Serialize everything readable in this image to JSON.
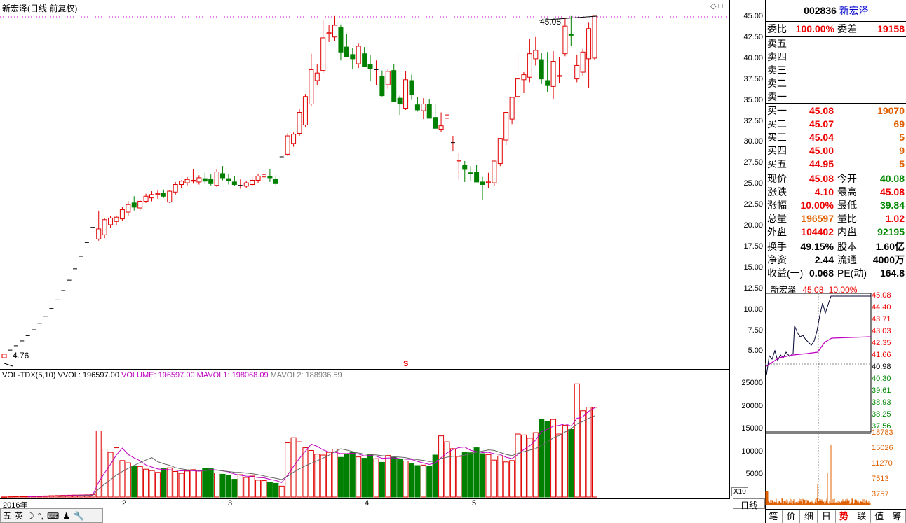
{
  "stock": {
    "code": "002836",
    "name": "新宏泽"
  },
  "chart": {
    "title": "新宏泽(日线 前复权)",
    "corner_icons": "◇ □",
    "high_label": "45.08",
    "low_label": "4.76",
    "marker_s": "S",
    "price_ticks": [
      "45.00",
      "42.50",
      "40.00",
      "37.50",
      "35.00",
      "32.50",
      "30.00",
      "27.50",
      "25.00",
      "22.50",
      "20.00",
      "17.50",
      "15.00",
      "12.50",
      "10.00",
      "7.50",
      "5.00"
    ],
    "vol_ticks": [
      "25000",
      "20000",
      "15000",
      "10000",
      "5000"
    ],
    "vol_multiplier": "X10",
    "date_labels": [
      "2016年",
      "2",
      "3",
      "4",
      "5"
    ],
    "period_tab": "日线",
    "volume_header": {
      "name": "VOL-TDX(5,10)",
      "vvol": "VVOL: 196597.00",
      "volume": "VOLUME: 196597.00",
      "mavol1": "MAVOL1: 198068.09",
      "mavol2": "MAVOL2: 188936.59"
    },
    "up_color": "#e00000",
    "down_color": "#008000",
    "candles": [
      [
        4.33,
        4.76,
        4.33,
        4.76
      ],
      [
        5.24,
        5.24,
        5.24,
        5.24
      ],
      [
        5.76,
        5.76,
        5.76,
        5.76
      ],
      [
        6.34,
        6.34,
        6.34,
        6.34
      ],
      [
        6.97,
        6.97,
        6.97,
        6.97
      ],
      [
        7.67,
        7.67,
        7.67,
        7.67
      ],
      [
        8.44,
        8.44,
        8.44,
        8.44
      ],
      [
        9.28,
        9.28,
        9.28,
        9.28
      ],
      [
        10.21,
        10.21,
        10.21,
        10.21
      ],
      [
        11.23,
        11.23,
        11.23,
        11.23
      ],
      [
        12.35,
        12.35,
        12.35,
        12.35
      ],
      [
        13.59,
        13.59,
        13.59,
        13.59
      ],
      [
        14.95,
        14.95,
        14.95,
        14.95
      ],
      [
        16.44,
        16.44,
        16.44,
        16.44
      ],
      [
        18.08,
        18.08,
        18.08,
        18.08
      ],
      [
        19.89,
        19.89,
        19.89,
        19.89
      ],
      [
        18.5,
        21.88,
        18.3,
        19.7
      ],
      [
        19.0,
        21.0,
        18.6,
        20.8
      ],
      [
        20.2,
        21.2,
        19.8,
        21.0
      ],
      [
        20.6,
        21.3,
        20.1,
        21.1
      ],
      [
        20.9,
        22.3,
        20.7,
        22.0
      ],
      [
        21.7,
        23.0,
        21.2,
        22.6
      ],
      [
        22.8,
        23.6,
        21.9,
        22.3
      ],
      [
        22.2,
        23.2,
        21.8,
        23.0
      ],
      [
        23.0,
        23.9,
        22.8,
        23.6
      ],
      [
        23.4,
        24.2,
        23.0,
        23.8
      ],
      [
        23.8,
        24.3,
        23.3,
        23.9
      ],
      [
        24.0,
        24.4,
        23.4,
        23.6
      ],
      [
        22.9,
        24.3,
        22.8,
        24.2
      ],
      [
        24.1,
        25.3,
        23.8,
        25.0
      ],
      [
        25.0,
        25.5,
        24.6,
        25.4
      ],
      [
        25.2,
        25.9,
        24.9,
        25.6
      ],
      [
        25.4,
        26.8,
        25.1,
        25.5
      ],
      [
        25.3,
        26.1,
        25.0,
        25.8
      ],
      [
        25.7,
        26.4,
        25.1,
        25.4
      ],
      [
        25.6,
        26.2,
        24.9,
        25.1
      ],
      [
        24.9,
        26.8,
        24.7,
        26.5
      ],
      [
        26.3,
        27.2,
        25.5,
        25.8
      ],
      [
        25.7,
        26.3,
        25.0,
        25.5
      ],
      [
        25.3,
        26.0,
        24.8,
        25.0
      ],
      [
        24.9,
        25.6,
        24.5,
        24.9
      ],
      [
        24.8,
        25.4,
        24.6,
        25.2
      ],
      [
        25.0,
        25.9,
        24.8,
        25.5
      ],
      [
        25.5,
        26.3,
        25.2,
        26.0
      ],
      [
        25.9,
        26.6,
        25.4,
        26.2
      ],
      [
        26.0,
        26.8,
        25.3,
        25.8
      ],
      [
        25.6,
        26.1,
        24.9,
        25.1
      ],
      [
        28.3,
        28.3,
        28.3,
        28.3
      ],
      [
        28.6,
        31.1,
        28.4,
        30.8
      ],
      [
        29.9,
        31.2,
        29.5,
        31.0
      ],
      [
        31.1,
        34.0,
        30.8,
        33.6
      ],
      [
        32.1,
        35.8,
        31.9,
        35.5
      ],
      [
        34.6,
        40.6,
        34.3,
        38.7
      ],
      [
        37.4,
        39.4,
        36.9,
        38.3
      ],
      [
        38.6,
        44.6,
        38.3,
        42.5
      ],
      [
        43.0,
        44.0,
        42.0,
        43.1
      ],
      [
        42.6,
        45.1,
        42.1,
        44.0
      ],
      [
        43.7,
        44.1,
        39.8,
        40.8
      ],
      [
        41.4,
        43.0,
        40.2,
        40.2
      ],
      [
        40.5,
        41.3,
        38.8,
        40.0
      ],
      [
        39.4,
        41.8,
        38.9,
        41.5
      ],
      [
        40.6,
        41.4,
        39.5,
        39.1
      ],
      [
        39.3,
        40.4,
        37.3,
        38.8
      ],
      [
        38.7,
        39.8,
        36.9,
        38.7
      ],
      [
        37.9,
        38.6,
        35.5,
        35.6
      ],
      [
        36.9,
        38.8,
        36.4,
        38.5
      ],
      [
        38.6,
        39.4,
        35.1,
        34.9
      ],
      [
        35.3,
        35.6,
        33.3,
        34.6
      ],
      [
        34.1,
        38.5,
        33.9,
        37.5
      ],
      [
        37.4,
        38.1,
        35.1,
        35.7
      ],
      [
        34.5,
        35.4,
        33.7,
        33.9
      ],
      [
        33.8,
        35.3,
        32.8,
        34.6
      ],
      [
        34.6,
        35.2,
        33.9,
        32.9
      ],
      [
        33.0,
        34.6,
        32.3,
        31.7
      ],
      [
        31.6,
        33.6,
        31.3,
        32.0
      ],
      [
        32.9,
        34.2,
        32.2,
        33.3
      ],
      [
        30.0,
        30.8,
        29.0,
        30.0
      ],
      [
        27.8,
        28.8,
        25.6,
        27.9
      ],
      [
        27.3,
        27.8,
        25.3,
        26.8
      ],
      [
        26.4,
        27.2,
        25.4,
        26.3
      ],
      [
        26.5,
        27.3,
        25.9,
        25.3
      ],
      [
        25.3,
        25.9,
        23.2,
        25.0
      ],
      [
        25.2,
        26.4,
        24.6,
        25.3
      ],
      [
        25.2,
        26.9,
        24.8,
        27.8
      ],
      [
        27.5,
        30.4,
        27.2,
        30.5
      ],
      [
        30.3,
        32.6,
        29.7,
        33.6
      ],
      [
        32.8,
        35.2,
        32.2,
        35.4
      ],
      [
        35.5,
        40.8,
        35.2,
        37.6
      ],
      [
        37.5,
        38.4,
        35.9,
        38.1
      ],
      [
        37.8,
        42.4,
        37.2,
        40.6
      ],
      [
        40.0,
        42.6,
        39.2,
        41.0
      ],
      [
        39.9,
        40.7,
        37.0,
        37.6
      ],
      [
        37.4,
        40.8,
        36.0,
        36.8
      ],
      [
        36.7,
        40.9,
        35.2,
        39.7
      ],
      [
        37.9,
        40.2,
        37.1,
        38.0
      ],
      [
        40.6,
        44.9,
        40.3,
        43.9
      ],
      [
        42.9,
        45.1,
        41.5,
        42.8
      ],
      [
        37.6,
        40.5,
        37.2,
        39.2
      ],
      [
        38.4,
        41.2,
        38.0,
        40.8
      ],
      [
        40.0,
        44.3,
        36.5,
        43.6
      ],
      [
        40.08,
        45.08,
        39.84,
        45.08
      ]
    ],
    "volumes": [
      20,
      60,
      90,
      110,
      150,
      180,
      200,
      250,
      300,
      330,
      370,
      400,
      430,
      450,
      480,
      520,
      14500,
      10500,
      9800,
      10800,
      8000,
      7500,
      6800,
      6700,
      6100,
      5800,
      5400,
      6200,
      6400,
      5600,
      5200,
      5700,
      6000,
      5900,
      6300,
      6200,
      5300,
      5000,
      4800,
      3900,
      4900,
      4300,
      4600,
      3700,
      3600,
      3200,
      3000,
      2400,
      11900,
      13000,
      12100,
      10800,
      10200,
      9400,
      9200,
      9800,
      10500,
      8700,
      9300,
      9800,
      8800,
      8500,
      9200,
      8400,
      7600,
      9100,
      8700,
      8200,
      7900,
      7300,
      6900,
      7000,
      6700,
      9200,
      13400,
      12100,
      10600,
      8900,
      9800,
      9700,
      10800,
      9500,
      9300,
      8100,
      9000,
      7700,
      8000,
      13800,
      13600,
      12900,
      14100,
      17100,
      16500,
      17000,
      13800,
      15700,
      14800,
      24800,
      18900,
      19700,
      19660
    ],
    "ma_volume": [
      20000
    ],
    "ma1": [
      0
    ]
  },
  "quote": {
    "weibi_label": "委比",
    "weibi_value": "100.00%",
    "weicha_label": "委差",
    "weicha_value": "19158",
    "sell": [
      {
        "label": "卖五",
        "price": "",
        "vol": ""
      },
      {
        "label": "卖四",
        "price": "",
        "vol": ""
      },
      {
        "label": "卖三",
        "price": "",
        "vol": ""
      },
      {
        "label": "卖二",
        "price": "",
        "vol": ""
      },
      {
        "label": "卖一",
        "price": "",
        "vol": ""
      }
    ],
    "buy": [
      {
        "label": "买一",
        "price": "45.08",
        "vol": "19070"
      },
      {
        "label": "买二",
        "price": "45.07",
        "vol": "69"
      },
      {
        "label": "买三",
        "price": "45.04",
        "vol": "5"
      },
      {
        "label": "买四",
        "price": "45.00",
        "vol": "9"
      },
      {
        "label": "买五",
        "price": "44.95",
        "vol": "5"
      }
    ],
    "stats1": [
      {
        "k1": "现价",
        "v1": "45.08",
        "c1": "red",
        "k2": "今开",
        "v2": "40.08",
        "c2": "green"
      },
      {
        "k1": "涨跌",
        "v1": "4.10",
        "c1": "red",
        "k2": "最高",
        "v2": "45.08",
        "c2": "red"
      },
      {
        "k1": "涨幅",
        "v1": "10.00%",
        "c1": "red",
        "k2": "最低",
        "v2": "39.84",
        "c2": "green"
      },
      {
        "k1": "总量",
        "v1": "196597",
        "c1": "orange",
        "k2": "量比",
        "v2": "1.02",
        "c2": "red"
      },
      {
        "k1": "外盘",
        "v1": "104402",
        "c1": "red",
        "k2": "内盘",
        "v2": "92195",
        "c2": "green"
      }
    ],
    "stats2": [
      {
        "k1": "换手",
        "v1": "49.15%",
        "c1": "",
        "k2": "股本",
        "v2": "1.60亿",
        "c2": ""
      },
      {
        "k1": "净资",
        "v1": "2.44",
        "c1": "",
        "k2": "流通",
        "v2": "4000万",
        "c2": ""
      },
      {
        "k1": "收益(一)",
        "v1": "0.068",
        "c1": "",
        "k2": "PE(动)",
        "v2": "164.8",
        "c2": ""
      }
    ]
  },
  "minichart": {
    "name": "新宏泽",
    "price": "45.08",
    "pct": "10.00%",
    "price_ticks": [
      {
        "v": "45.08",
        "c": "red"
      },
      {
        "v": "44.40",
        "c": "red"
      },
      {
        "v": "43.71",
        "c": "red"
      },
      {
        "v": "43.03",
        "c": "red"
      },
      {
        "v": "42.35",
        "c": "red"
      },
      {
        "v": "41.66",
        "c": "red"
      },
      {
        "v": "40.98",
        "c": "black"
      },
      {
        "v": "40.30",
        "c": "green"
      },
      {
        "v": "39.61",
        "c": "green"
      },
      {
        "v": "38.93",
        "c": "green"
      },
      {
        "v": "38.25",
        "c": "green"
      },
      {
        "v": "37.56",
        "c": "green"
      }
    ],
    "vol_ticks": [
      "18783",
      "15026",
      "11270",
      "7513",
      "3757"
    ]
  },
  "status_bar": [
    "五",
    "英",
    "☽",
    "°,",
    "⌨",
    "♟",
    "🔧"
  ],
  "tabs": [
    "笔",
    "价",
    "细",
    "日",
    "势",
    "联",
    "值",
    "筹"
  ],
  "active_tab": 4
}
